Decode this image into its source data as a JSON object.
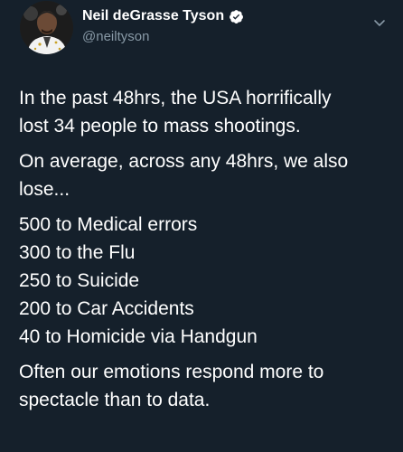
{
  "author": {
    "display_name": "Neil deGrasse Tyson",
    "handle": "@neiltyson",
    "avatar_icon": "avatar-photo",
    "verified_icon": "verified-badge-icon",
    "menu_icon": "chevron-down-icon"
  },
  "tweet": {
    "paragraph1": [
      "In the past 48hrs, the USA horrifically",
      "lost 34 people to mass shootings."
    ],
    "paragraph2": [
      "On average, across any 48hrs, we also",
      "lose..."
    ],
    "list": [
      "500 to Medical errors",
      "300 to the Flu",
      "250 to Suicide",
      "200 to Car Accidents",
      "40 to Homicide via Handgun"
    ],
    "paragraph3": [
      "Often our emotions respond more to",
      "spectacle than to data."
    ]
  },
  "colors": {
    "background": "#15202b",
    "text": "#ffffff",
    "secondary_text": "#8899a6",
    "verified": "#ffffff"
  }
}
